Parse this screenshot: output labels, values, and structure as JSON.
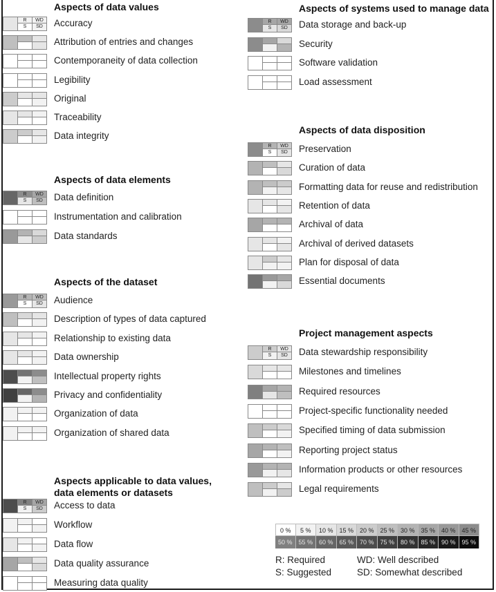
{
  "sub_labels": {
    "r": "R",
    "s": "S",
    "wd": "WD",
    "sd": "SD"
  },
  "shade_scale_percent": "Cell shading intensity = percentage (0 % white to 95 % near-black)",
  "sections": [
    {
      "title": "Aspects of data values",
      "column": "left",
      "items": [
        {
          "label": "Accuracy",
          "overall": 10,
          "r": 5,
          "s": 0,
          "wd": 5,
          "sd": 5,
          "show_labels": true
        },
        {
          "label": "Attribution of entries and changes",
          "overall": 25,
          "r": 25,
          "s": 0,
          "wd": 10,
          "sd": 10
        },
        {
          "label": "Contemporaneity of data collection",
          "overall": 0,
          "r": 0,
          "s": 0,
          "wd": 0,
          "sd": 0
        },
        {
          "label": "Legibility",
          "overall": 0,
          "r": 0,
          "s": 0,
          "wd": 0,
          "sd": 0
        },
        {
          "label": "Original",
          "overall": 20,
          "r": 10,
          "s": 0,
          "wd": 10,
          "sd": 5
        },
        {
          "label": "Traceability",
          "overall": 10,
          "r": 10,
          "s": 0,
          "wd": 5,
          "sd": 0
        },
        {
          "label": "Data integrity",
          "overall": 20,
          "r": 20,
          "s": 0,
          "wd": 10,
          "sd": 5
        }
      ]
    },
    {
      "title": "Aspects of data elements",
      "column": "left",
      "items": [
        {
          "label": "Data definition",
          "overall": 60,
          "r": 45,
          "s": 10,
          "wd": 35,
          "sd": 25,
          "show_labels": true
        },
        {
          "label": "Instrumentation and calibration",
          "overall": 0,
          "r": 0,
          "s": 0,
          "wd": 0,
          "sd": 0
        },
        {
          "label": "Data standards",
          "overall": 40,
          "r": 30,
          "s": 10,
          "wd": 15,
          "sd": 20
        }
      ]
    },
    {
      "title": "Aspects of the dataset",
      "column": "left",
      "items": [
        {
          "label": "Audience",
          "overall": 40,
          "r": 30,
          "s": 0,
          "wd": 25,
          "sd": 10,
          "show_labels": true
        },
        {
          "label": "Description of types of data captured",
          "overall": 25,
          "r": 15,
          "s": 0,
          "wd": 10,
          "sd": 5
        },
        {
          "label": "Relationship to existing data",
          "overall": 10,
          "r": 10,
          "s": 0,
          "wd": 5,
          "sd": 0
        },
        {
          "label": "Data ownership",
          "overall": 10,
          "r": 10,
          "s": 0,
          "wd": 5,
          "sd": 5
        },
        {
          "label": "Intellectual property rights",
          "overall": 70,
          "r": 55,
          "s": 5,
          "wd": 45,
          "sd": 25
        },
        {
          "label": "Privacy and confidentiality",
          "overall": 75,
          "r": 60,
          "s": 5,
          "wd": 45,
          "sd": 30
        },
        {
          "label": "Organization of data",
          "overall": 5,
          "r": 5,
          "s": 0,
          "wd": 5,
          "sd": 0
        },
        {
          "label": "Organization of shared data",
          "overall": 5,
          "r": 5,
          "s": 0,
          "wd": 5,
          "sd": 0
        }
      ]
    },
    {
      "title": "Aspects applicable to data values,",
      "title_line2": "data elements or datasets",
      "column": "left",
      "items": [
        {
          "label": "Access to data",
          "overall": 70,
          "r": 50,
          "s": 5,
          "wd": 35,
          "sd": 20,
          "show_labels": true
        },
        {
          "label": "Workflow",
          "overall": 5,
          "r": 5,
          "s": 0,
          "wd": 0,
          "sd": 5
        },
        {
          "label": "Data flow",
          "overall": 10,
          "r": 5,
          "s": 0,
          "wd": 0,
          "sd": 5
        },
        {
          "label": "Data quality assurance",
          "overall": 35,
          "r": 25,
          "s": 0,
          "wd": 10,
          "sd": 15
        },
        {
          "label": "Measuring data quality",
          "overall": 0,
          "r": 0,
          "s": 0,
          "wd": 0,
          "sd": 0
        }
      ]
    },
    {
      "title": "Aspects of systems used to manage data",
      "column": "right",
      "items": [
        {
          "label": "Data storage and back-up",
          "overall": 45,
          "r": 35,
          "s": 10,
          "wd": 35,
          "sd": 15,
          "show_labels": true
        },
        {
          "label": "Security",
          "overall": 45,
          "r": 35,
          "s": 5,
          "wd": 15,
          "sd": 30
        },
        {
          "label": "Software validation",
          "overall": 0,
          "r": 0,
          "s": 0,
          "wd": 0,
          "sd": 0
        },
        {
          "label": "Load assessment",
          "overall": 0,
          "r": 0,
          "s": 0,
          "wd": 0,
          "sd": 0
        }
      ]
    },
    {
      "title": "Aspects of data disposition",
      "column": "right",
      "items": [
        {
          "label": "Preservation",
          "overall": 45,
          "r": 30,
          "s": 0,
          "wd": 20,
          "sd": 10,
          "show_labels": true
        },
        {
          "label": "Curation of data",
          "overall": 30,
          "r": 25,
          "s": 0,
          "wd": 10,
          "sd": 15
        },
        {
          "label": "Formatting data for reuse and redistribution",
          "overall": 30,
          "r": 25,
          "s": 5,
          "wd": 20,
          "sd": 10
        },
        {
          "label": "Retention of data",
          "overall": 10,
          "r": 10,
          "s": 0,
          "wd": 5,
          "sd": 10
        },
        {
          "label": "Archival of data",
          "overall": 35,
          "r": 30,
          "s": 0,
          "wd": 30,
          "sd": 0
        },
        {
          "label": "Archival of derived datasets",
          "overall": 10,
          "r": 10,
          "s": 0,
          "wd": 5,
          "sd": 10
        },
        {
          "label": "Plan for disposal of data",
          "overall": 10,
          "r": 20,
          "s": 5,
          "wd": 10,
          "sd": 5
        },
        {
          "label": "Essential documents",
          "overall": 55,
          "r": 40,
          "s": 5,
          "wd": 35,
          "sd": 15
        }
      ]
    },
    {
      "title": "Project management aspects",
      "column": "right",
      "items": [
        {
          "label": "Data stewardship responsibility",
          "overall": 20,
          "r": 20,
          "s": 5,
          "wd": 10,
          "sd": 10,
          "show_labels": true
        },
        {
          "label": "Milestones and timelines",
          "overall": 15,
          "r": 10,
          "s": 0,
          "wd": 10,
          "sd": 0
        },
        {
          "label": "Required resources",
          "overall": 50,
          "r": 35,
          "s": 10,
          "wd": 30,
          "sd": 25
        },
        {
          "label": "Project-specific functionality needed",
          "overall": 0,
          "r": 0,
          "s": 0,
          "wd": 0,
          "sd": 0
        },
        {
          "label": "Specified timing of data submission",
          "overall": 25,
          "r": 20,
          "s": 0,
          "wd": 15,
          "sd": 5
        },
        {
          "label": "Reporting project status",
          "overall": 35,
          "r": 30,
          "s": 0,
          "wd": 25,
          "sd": 5
        },
        {
          "label": "Information products or other resources",
          "overall": 40,
          "r": 30,
          "s": 5,
          "wd": 30,
          "sd": 10
        },
        {
          "label": "Legal requirements",
          "overall": 25,
          "r": 20,
          "s": 5,
          "wd": 10,
          "sd": 20
        }
      ]
    }
  ],
  "legend": {
    "scale_top": [
      "0 %",
      "5 %",
      "10 %",
      "15 %",
      "20 %",
      "25 %",
      "30 %",
      "35 %",
      "40 %",
      "45 %"
    ],
    "scale_bottom": [
      "50 %",
      "55 %",
      "60 %",
      "65 %",
      "70 %",
      "75 %",
      "80 %",
      "85 %",
      "90 %",
      "95 %"
    ],
    "r": "R: Required",
    "s": "S: Suggested",
    "wd": "WD: Well described",
    "sd": "SD: Somewhat described"
  }
}
